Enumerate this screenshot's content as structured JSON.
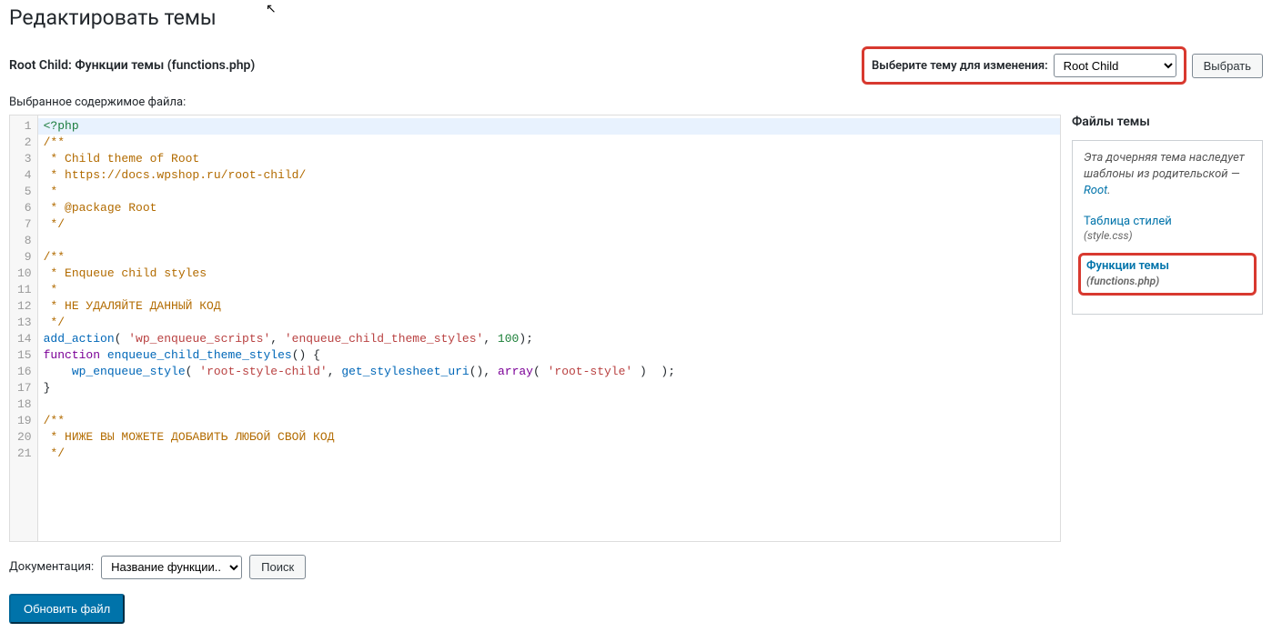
{
  "page": {
    "title": "Редактировать темы"
  },
  "header": {
    "file_heading": "Root Child: Функции темы (functions.php)",
    "selector_label": "Выберите тему для изменения:",
    "selected_theme": "Root Child",
    "select_button": "Выбрать"
  },
  "editor": {
    "label": "Выбранное содержимое файла:",
    "line_count": 21,
    "code_raw": "<?php\n/**\n * Child theme of Root\n * https://docs.wpshop.ru/root-child/\n *\n * @package Root\n */\n\n/**\n * Enqueue child styles\n *\n * НЕ УДАЛЯЙТЕ ДАННЫЙ КОД\n */\nadd_action( 'wp_enqueue_scripts', 'enqueue_child_theme_styles', 100);\nfunction enqueue_child_theme_styles() {\n    wp_enqueue_style( 'root-style-child', get_stylesheet_uri(), array( 'root-style' )  );\n}\n\n/**\n * НИЖЕ ВЫ МОЖЕТЕ ДОБАВИТЬ ЛЮБОЙ СВОЙ КОД\n */"
  },
  "sidebar": {
    "heading": "Файлы темы",
    "parent_note_pre": "Эта дочерняя тема наследует шаблоны из родительской — ",
    "parent_link": "Root",
    "files": [
      {
        "label": "Таблица стилей",
        "filename": "(style.css)",
        "active": false
      },
      {
        "label": "Функции темы",
        "filename": "(functions.php)",
        "active": true
      }
    ]
  },
  "docs": {
    "label": "Документация:",
    "select_placeholder": "Название функции...",
    "search_button": "Поиск"
  },
  "actions": {
    "update_button": "Обновить файл"
  }
}
